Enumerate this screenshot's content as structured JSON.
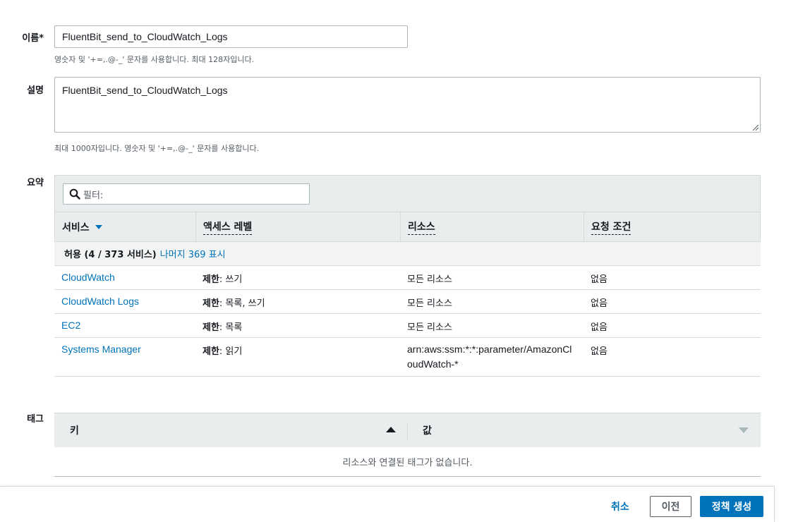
{
  "form": {
    "name_label": "이름*",
    "name_value": "FluentBit_send_to_CloudWatch_Logs",
    "name_hint": "영숫자 및 '+=,.@-_' 문자를 사용합니다. 최대 128자입니다.",
    "desc_label": "설명",
    "desc_value": "FluentBit_send_to_CloudWatch_Logs",
    "desc_hint": "최대 1000자입니다. 영숫자 및 '+=,.@-_' 문자를 사용합니다."
  },
  "summary": {
    "label": "요약",
    "filter_placeholder": "필터:",
    "columns": [
      "서비스",
      "액세스 레벨",
      "리소스",
      "요청 조건"
    ],
    "group_label": "허용 (4 / 373 서비스)",
    "group_link": "나머지 369 표시",
    "rows": [
      {
        "service": "CloudWatch",
        "access_level": "제한",
        "access_detail": ": 쓰기",
        "resource": "모든 리소스",
        "condition": "없음"
      },
      {
        "service": "CloudWatch Logs",
        "access_level": "제한",
        "access_detail": ": 목록, 쓰기",
        "resource": "모든 리소스",
        "condition": "없음"
      },
      {
        "service": "EC2",
        "access_level": "제한",
        "access_detail": ": 목록",
        "resource": "모든 리소스",
        "condition": "없음"
      },
      {
        "service": "Systems Manager",
        "access_level": "제한",
        "access_detail": ": 읽기",
        "resource": "arn:aws:ssm:*:*:parameter/AmazonCloudWatch-*",
        "condition": "없음"
      }
    ]
  },
  "tags": {
    "label": "태그",
    "key_header": "키",
    "value_header": "값",
    "empty_text": "리소스와 연결된 태그가 없습니다."
  },
  "footer": {
    "cancel": "취소",
    "previous": "이전",
    "create": "정책 생성"
  },
  "colors": {
    "accent": "#0073bb",
    "header_bg": "#eaeded",
    "border": "#d5dbdb"
  }
}
